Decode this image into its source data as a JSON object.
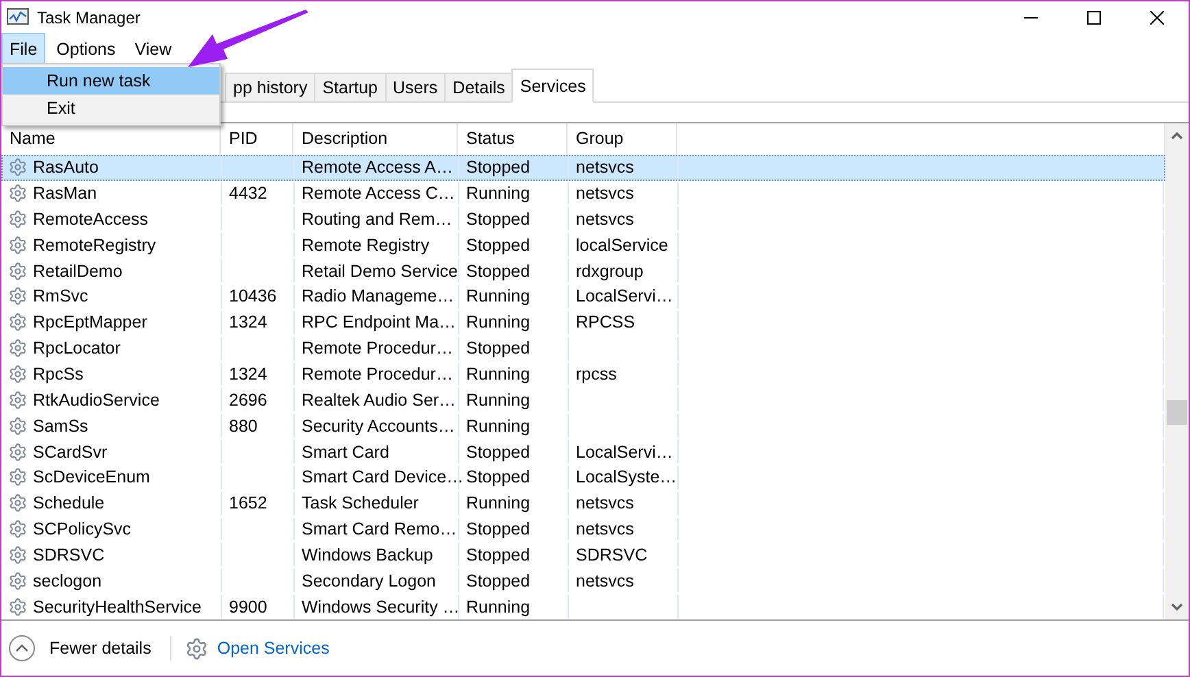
{
  "window": {
    "title": "Task Manager"
  },
  "menu_bar": [
    {
      "label": "File",
      "selected": true
    },
    {
      "label": "Options",
      "selected": false
    },
    {
      "label": "View",
      "selected": false
    }
  ],
  "file_menu": [
    {
      "label": "Run new task",
      "selected": true
    },
    {
      "label": "Exit",
      "selected": false
    }
  ],
  "tabs": [
    {
      "label": "pp history",
      "selected": false
    },
    {
      "label": "Startup",
      "selected": false
    },
    {
      "label": "Users",
      "selected": false
    },
    {
      "label": "Details",
      "selected": false
    },
    {
      "label": "Services",
      "selected": true
    }
  ],
  "table": {
    "columns": [
      "Name",
      "PID",
      "Description",
      "Status",
      "Group"
    ],
    "rows": [
      {
        "name": "RasAuto",
        "description": "Remote Access A…",
        "status": "Stopped",
        "group": "netsvcs",
        "selected": true
      },
      {
        "name": "RasMan",
        "pid": "4432",
        "description": "Remote Access C…",
        "status": "Running",
        "group": "netsvcs",
        "selected": false
      },
      {
        "name": "RemoteAccess",
        "description": "Routing and Rem…",
        "status": "Stopped",
        "group": "netsvcs",
        "selected": false
      },
      {
        "name": "RemoteRegistry",
        "description": "Remote Registry",
        "status": "Stopped",
        "group": "localService",
        "selected": false
      },
      {
        "name": "RetailDemo",
        "description": "Retail Demo Service",
        "status": "Stopped",
        "group": "rdxgroup",
        "selected": false
      },
      {
        "name": "RmSvc",
        "pid": "10436",
        "description": "Radio Manageme…",
        "status": "Running",
        "group": "LocalServi…",
        "selected": false
      },
      {
        "name": "RpcEptMapper",
        "pid": "1324",
        "description": "RPC Endpoint Ma…",
        "status": "Running",
        "group": "RPCSS",
        "selected": false
      },
      {
        "name": "RpcLocator",
        "description": "Remote Procedur…",
        "status": "Stopped",
        "selected": false
      },
      {
        "name": "RpcSs",
        "pid": "1324",
        "description": "Remote Procedur…",
        "status": "Running",
        "group": "rpcss",
        "selected": false
      },
      {
        "name": "RtkAudioService",
        "pid": "2696",
        "description": "Realtek Audio Ser…",
        "status": "Running",
        "selected": false
      },
      {
        "name": "SamSs",
        "pid": "880",
        "description": "Security Accounts…",
        "status": "Running",
        "selected": false
      },
      {
        "name": "SCardSvr",
        "description": "Smart Card",
        "status": "Stopped",
        "group": "LocalServi…",
        "selected": false
      },
      {
        "name": "ScDeviceEnum",
        "description": "Smart Card Device…",
        "status": "Stopped",
        "group": "LocalSyste…",
        "selected": false
      },
      {
        "name": "Schedule",
        "pid": "1652",
        "description": "Task Scheduler",
        "status": "Running",
        "group": "netsvcs",
        "selected": false
      },
      {
        "name": "SCPolicySvc",
        "description": "Smart Card Remo…",
        "status": "Stopped",
        "group": "netsvcs",
        "selected": false
      },
      {
        "name": "SDRSVC",
        "description": "Windows Backup",
        "status": "Stopped",
        "group": "SDRSVC",
        "selected": false
      },
      {
        "name": "seclogon",
        "description": "Secondary Logon",
        "status": "Stopped",
        "group": "netsvcs",
        "selected": false
      },
      {
        "name": "SecurityHealthService",
        "pid": "9900",
        "description": "Windows Security …",
        "status": "Running",
        "selected": false
      }
    ]
  },
  "footer": {
    "toggle": "Fewer details",
    "link": "Open Services"
  }
}
